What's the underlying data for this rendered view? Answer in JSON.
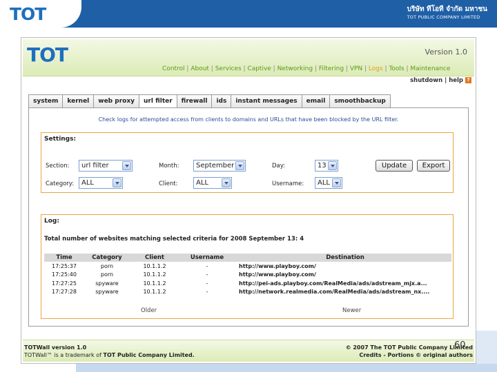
{
  "banner": {
    "logo": "TOT",
    "company_thai": "บริษัท ทีโอที จำกัด มหาชน",
    "company_eng": "TOT PUBLIC COMPANY LIMITED"
  },
  "app": {
    "logo": "TOT",
    "version": "Version 1.0",
    "nav": [
      "Control",
      "About",
      "Services",
      "Captive",
      "Networking",
      "Filtering",
      "VPN",
      "Logs",
      "Tools",
      "Maintenance"
    ],
    "active_nav": "Logs",
    "shutdown": "shutdown",
    "help": "help"
  },
  "tabs": [
    "system",
    "kernel",
    "web proxy",
    "url filter",
    "firewall",
    "ids",
    "instant messages",
    "email",
    "smoothbackup"
  ],
  "active_tab": "url filter",
  "intro": "Check logs for attempted access from clients to domains and URLs that have been blocked by the URL filter.",
  "settings": {
    "legend": "Settings:",
    "section_label": "Section:",
    "section_value": "url filter",
    "month_label": "Month:",
    "month_value": "September",
    "day_label": "Day:",
    "day_value": "13",
    "category_label": "Category:",
    "category_value": "ALL",
    "client_label": "Client:",
    "client_value": "ALL",
    "username_label": "Username:",
    "username_value": "ALL",
    "update_button": "Update",
    "export_button": "Export"
  },
  "log": {
    "legend": "Log:",
    "summary": "Total number of websites matching selected criteria for 2008 September 13: 4",
    "columns": [
      "Time",
      "Category",
      "Client",
      "Username",
      "Destination"
    ],
    "rows": [
      [
        "17:25:37",
        "porn",
        "10.1.1.2",
        "-",
        "http://www.playboy.com/"
      ],
      [
        "17:25:40",
        "porn",
        "10.1.1.2",
        "-",
        "http://www.playboy.com/"
      ],
      [
        "17:27:25",
        "spyware",
        "10.1.1.2",
        "-",
        "http://pei-ads.playboy.com/RealMedia/ads/adstream_mjx.a..."
      ],
      [
        "17:27:28",
        "spyware",
        "10.1.1.2",
        "-",
        "http://network.realmedia.com/RealMedia/ads/adstream_nx...."
      ]
    ],
    "older": "Older",
    "newer": "Newer"
  },
  "footer": {
    "left_line1": "TOTWall version 1.0",
    "left_line2_a": "TOTWall™ is a trademark of ",
    "left_line2_b": "TOT Public Company Limited.",
    "right_line1": "© 2007 The TOT Public Company Limited",
    "right_line2_a": "Credits - Portions © original authors"
  },
  "page_number": "60",
  "colors": {
    "banner_blue": "#1f5fa6",
    "nav_green": "#5a9a1a",
    "nav_active": "#e0a020",
    "fieldset_border": "#e8a640"
  }
}
